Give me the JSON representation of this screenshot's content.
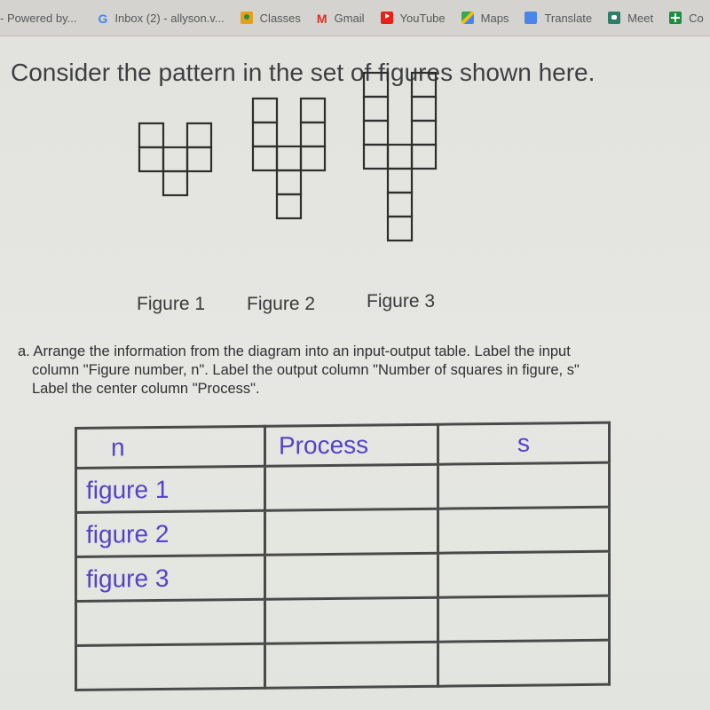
{
  "bookmarks": [
    {
      "label": "- Powered by...",
      "icon": "none"
    },
    {
      "label": "Inbox (2) - allyson.v...",
      "icon": "google-icon"
    },
    {
      "label": "Classes",
      "icon": "google-classroom-icon"
    },
    {
      "label": "Gmail",
      "icon": "gmail-icon"
    },
    {
      "label": "YouTube",
      "icon": "youtube-icon"
    },
    {
      "label": "Maps",
      "icon": "maps-icon"
    },
    {
      "label": "Translate",
      "icon": "translate-icon"
    },
    {
      "label": "Meet",
      "icon": "meet-icon"
    },
    {
      "label": "Co",
      "icon": "sheets-icon"
    }
  ],
  "title": "Consider the pattern in the set of figures shown here.",
  "figures": [
    {
      "label": "Figure 1",
      "arm_squares": 2,
      "stem_squares": 1,
      "total_squares": 6
    },
    {
      "label": "Figure 2",
      "arm_squares": 3,
      "stem_squares": 2,
      "total_squares": 9
    },
    {
      "label": "Figure 3",
      "arm_squares": 4,
      "stem_squares": 3,
      "total_squares": 12
    }
  ],
  "question": {
    "line1": "a. Arrange the information from the diagram into an input-output table.  Label the input",
    "line2": "column \"Figure number, n\".  Label the output column \"Number of squares in figure, s\"",
    "line3": "Label the center column \"Process\"."
  },
  "table": {
    "headers": [
      "n",
      "Process",
      "s"
    ],
    "rows": [
      [
        "figure 1",
        "",
        ""
      ],
      [
        "figure 2",
        "",
        ""
      ],
      [
        "figure 3",
        "",
        ""
      ],
      [
        "",
        "",
        ""
      ],
      [
        "",
        "",
        ""
      ]
    ]
  }
}
